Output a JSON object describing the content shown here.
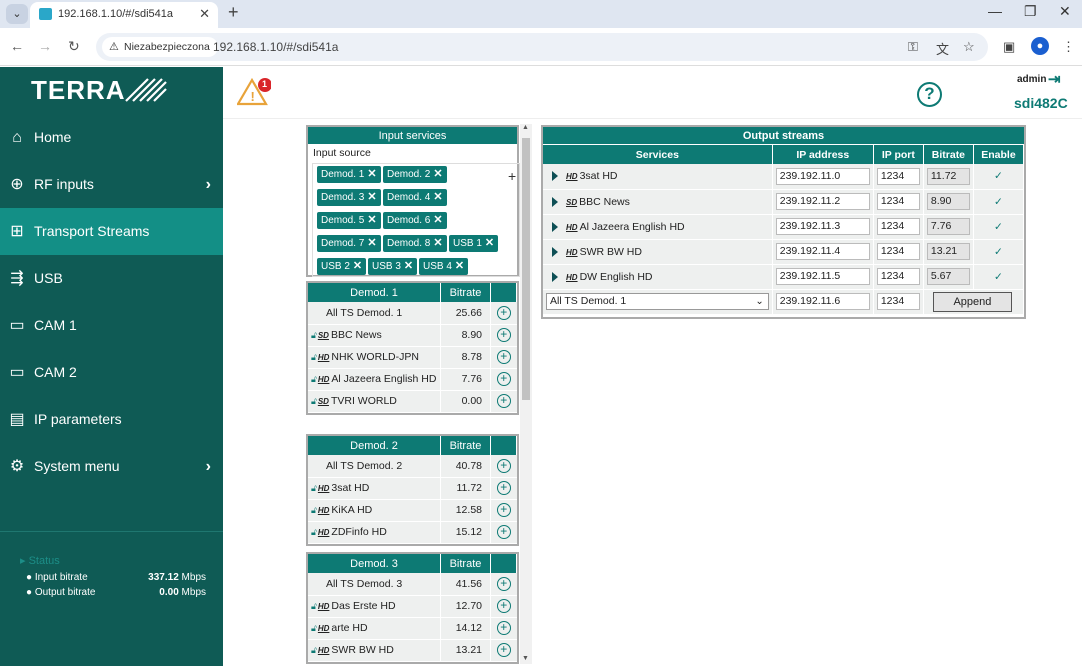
{
  "browser": {
    "tab_title": "192.168.1.10/#/sdi541a",
    "security_label": "Niezabezpieczona",
    "url": "192.168.1.10/#/sdi541a"
  },
  "sidebar": {
    "logo": "TERRA",
    "items": [
      {
        "label": "Home",
        "icon": "home-icon",
        "chevron": false
      },
      {
        "label": "RF inputs",
        "icon": "rf-input-icon",
        "chevron": true
      },
      {
        "label": "Transport Streams",
        "icon": "transport-stream-icon",
        "chevron": false,
        "active": true
      },
      {
        "label": "USB",
        "icon": "usb-icon",
        "chevron": false
      },
      {
        "label": "CAM 1",
        "icon": "cam-icon",
        "chevron": false
      },
      {
        "label": "CAM 2",
        "icon": "cam-icon",
        "chevron": false
      },
      {
        "label": "IP parameters",
        "icon": "network-card-icon",
        "chevron": false
      },
      {
        "label": "System menu",
        "icon": "gear-icon",
        "chevron": true
      }
    ],
    "status": {
      "title": "Status",
      "input_label": "Input bitrate",
      "input_value": "337.12",
      "output_label": "Output bitrate",
      "output_value": "0.00",
      "unit": "Mbps"
    }
  },
  "header": {
    "alert_count": "1",
    "user": "admin",
    "device": "sdi482C"
  },
  "input_services": {
    "title": "Input services",
    "source_label": "Input source",
    "chips": [
      "Demod. 1",
      "Demod. 2",
      "Demod. 3",
      "Demod. 4",
      "Demod. 5",
      "Demod. 6",
      "Demod. 7",
      "Demod. 8",
      "USB 1",
      "USB 2",
      "USB 3",
      "USB 4"
    ]
  },
  "demods": [
    {
      "title": "Demod. 1",
      "bitrate_label": "Bitrate",
      "rows": [
        {
          "name": "All TS Demod. 1",
          "bitrate": "25.66",
          "all": true
        },
        {
          "name": "BBC News",
          "bitrate": "8.90",
          "tag": "SD"
        },
        {
          "name": "NHK WORLD-JPN",
          "bitrate": "8.78",
          "tag": "HD"
        },
        {
          "name": "Al Jazeera English HD",
          "bitrate": "7.76",
          "tag": "HD"
        },
        {
          "name": "TVRI WORLD",
          "bitrate": "0.00",
          "tag": "SD"
        }
      ]
    },
    {
      "title": "Demod. 2",
      "bitrate_label": "Bitrate",
      "rows": [
        {
          "name": "All TS Demod. 2",
          "bitrate": "40.78",
          "all": true
        },
        {
          "name": "3sat HD",
          "bitrate": "11.72",
          "tag": "HD"
        },
        {
          "name": "KiKA HD",
          "bitrate": "12.58",
          "tag": "HD"
        },
        {
          "name": "ZDFinfo HD",
          "bitrate": "15.12",
          "tag": "HD"
        }
      ]
    },
    {
      "title": "Demod. 3",
      "bitrate_label": "Bitrate",
      "rows": [
        {
          "name": "All TS Demod. 3",
          "bitrate": "41.56",
          "all": true
        },
        {
          "name": "Das Erste HD",
          "bitrate": "12.70",
          "tag": "HD"
        },
        {
          "name": "arte HD",
          "bitrate": "14.12",
          "tag": "HD"
        },
        {
          "name": "SWR BW HD",
          "bitrate": "13.21",
          "tag": "HD"
        }
      ]
    }
  ],
  "output_streams": {
    "title": "Output streams",
    "columns": [
      "Services",
      "IP address",
      "IP port",
      "Bitrate",
      "Enable"
    ],
    "rows": [
      {
        "tag": "HD",
        "service": "3sat HD",
        "ip": "239.192.11.0",
        "port": "1234",
        "bitrate": "11.72",
        "enabled": true
      },
      {
        "tag": "SD",
        "service": "BBC News",
        "ip": "239.192.11.2",
        "port": "1234",
        "bitrate": "8.90",
        "enabled": true
      },
      {
        "tag": "HD",
        "service": "Al Jazeera English HD",
        "ip": "239.192.11.3",
        "port": "1234",
        "bitrate": "7.76",
        "enabled": true
      },
      {
        "tag": "HD",
        "service": "SWR BW HD",
        "ip": "239.192.11.4",
        "port": "1234",
        "bitrate": "13.21",
        "enabled": true
      },
      {
        "tag": "HD",
        "service": "DW English HD",
        "ip": "239.192.11.5",
        "port": "1234",
        "bitrate": "5.67",
        "enabled": true
      }
    ],
    "new_row": {
      "source": "All TS Demod. 1",
      "ip": "239.192.11.6",
      "port": "1234",
      "append_label": "Append"
    }
  },
  "colors": {
    "primary": "#0d7a74",
    "sidebar": "#0f5b55",
    "active": "#138f86"
  }
}
